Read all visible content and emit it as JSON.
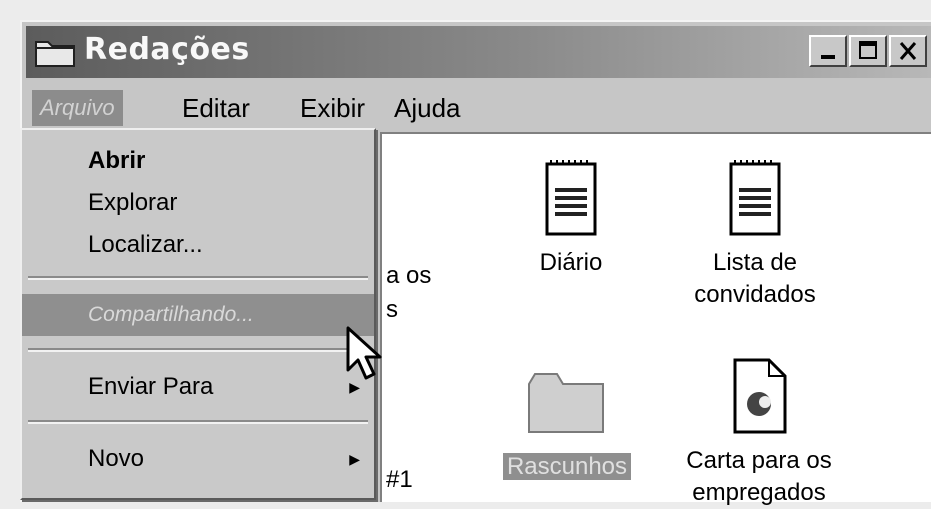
{
  "window": {
    "title": "Redações"
  },
  "menubar": {
    "items": [
      {
        "label": "Arquivo",
        "selected": true
      },
      {
        "label": "Editar"
      },
      {
        "label": "Exibir"
      },
      {
        "label": "Ajuda"
      }
    ]
  },
  "dropdown": {
    "items": [
      {
        "label": "Abrir",
        "bold": true
      },
      {
        "label": "Explorar"
      },
      {
        "label": "Localizar..."
      },
      {
        "label": "Compartilhando...",
        "highlighted": true
      },
      {
        "label": "Enviar Para",
        "has_submenu": true
      },
      {
        "label": "Novo",
        "has_submenu": true
      }
    ]
  },
  "content": {
    "partial_labels": [
      "a os",
      "s",
      "#1"
    ],
    "icons": [
      {
        "label": "Diário",
        "icon": "document-icon"
      },
      {
        "label_line1": "Lista de",
        "label_line2": "convidados",
        "icon": "document-icon"
      },
      {
        "label": "Rascunhos",
        "icon": "folder-icon",
        "selected": true
      },
      {
        "label_line1": "Carta para os",
        "label_line2": "empregados",
        "icon": "wordpad-document-icon"
      }
    ]
  },
  "colors": {
    "titlebar": "#5c5c5c",
    "menu_highlight": "#8f8f8f",
    "window_bg": "#c6c6c6"
  }
}
